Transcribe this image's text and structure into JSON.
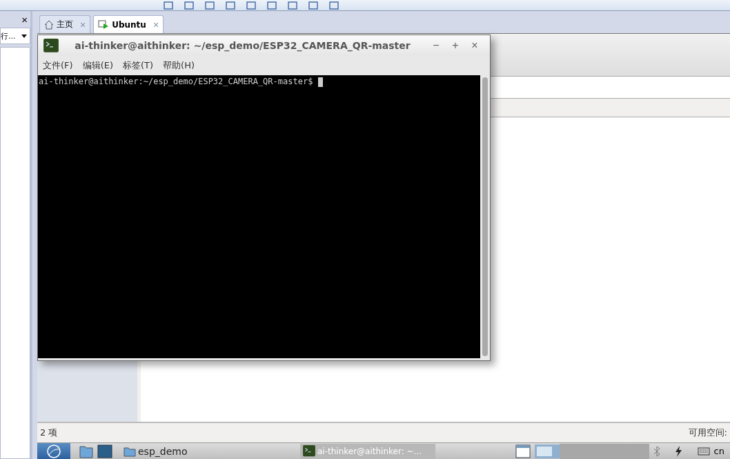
{
  "sidebar": {
    "close": "×",
    "dropdown": "行..."
  },
  "tabs": [
    {
      "label": "主页",
      "kind": "home",
      "selected": false,
      "close": "×"
    },
    {
      "label": "Ubuntu",
      "kind": "vm",
      "selected": true,
      "close": "×"
    }
  ],
  "terminal": {
    "title": "ai-thinker@aithinker: ~/esp_demo/ESP32_CAMERA_QR-master",
    "controls": [
      "−",
      "+",
      "×"
    ],
    "menu": [
      "文件(F)",
      "编辑(E)",
      "标签(T)",
      "帮助(H)"
    ],
    "prompt": "ai-thinker@aithinker:~/esp_demo/ESP32_CAMERA_QR-master$ "
  },
  "status_bar": {
    "items": "2 项",
    "free_space": "可用空间:"
  },
  "taskbar": {
    "tasks": [
      {
        "kind": "folder",
        "label": "esp_demo"
      },
      {
        "kind": "terminal",
        "label": "ai-thinker@aithinker: ~..."
      }
    ],
    "tray": "cn"
  }
}
